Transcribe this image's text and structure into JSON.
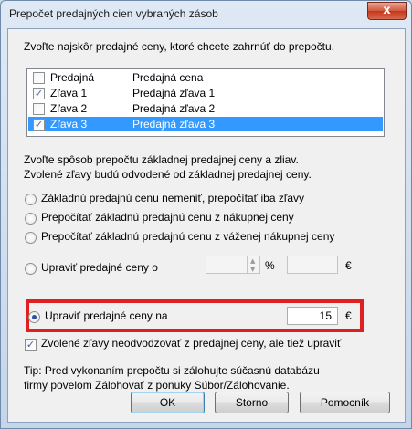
{
  "window": {
    "title": "Prepočet predajných cien vybraných zásob",
    "close_label": "x"
  },
  "intro": "Zvoľte najskôr predajné ceny, ktoré chcete zahrnúť do prepočtu.",
  "price_list": [
    {
      "name": "Predajná",
      "description": "Predajná cena",
      "checked": false,
      "selected": false
    },
    {
      "name": "Zľava 1",
      "description": "Predajná zľava 1",
      "checked": true,
      "selected": false
    },
    {
      "name": "Zľava 2",
      "description": "Predajná zľava 2",
      "checked": false,
      "selected": false
    },
    {
      "name": "Zľava 3",
      "description": "Predajná zľava 3",
      "checked": true,
      "selected": true
    }
  ],
  "method": {
    "heading_line1": "Zvoľte spôsob prepočtu základnej predajnej ceny a zliav.",
    "heading_line2": "Zvolené zľavy budú odvodené od základnej predajnej ceny.",
    "options": [
      "Základnú predajnú cenu nemeniť, prepočítať iba zľavy",
      "Prepočítať základnú predajnú cenu z nákupnej ceny",
      "Prepočítať základnú predajnú cenu z váženej nákupnej ceny"
    ],
    "adjust_percent_label": "Upraviť predajné ceny o",
    "percent_symbol": "%",
    "currency_symbol": "€",
    "adjust_to_label": "Upraviť predajné ceny na",
    "adjust_to_value": "15",
    "selected_option": "Upraviť predajné ceny na",
    "also_adjust_label": "Zvolené zľavy neodvodzovať z predajnej ceny, ale tiež upraviť",
    "also_adjust_checked": true
  },
  "tip": {
    "line1": "Tip: Pred vykonaním prepočtu si zálohujte súčasnú databázu",
    "line2": "firmy povelom Zálohovať z ponuky Súbor/Zálohovanie."
  },
  "buttons": {
    "ok": "OK",
    "cancel": "Storno",
    "help": "Pomocník"
  }
}
